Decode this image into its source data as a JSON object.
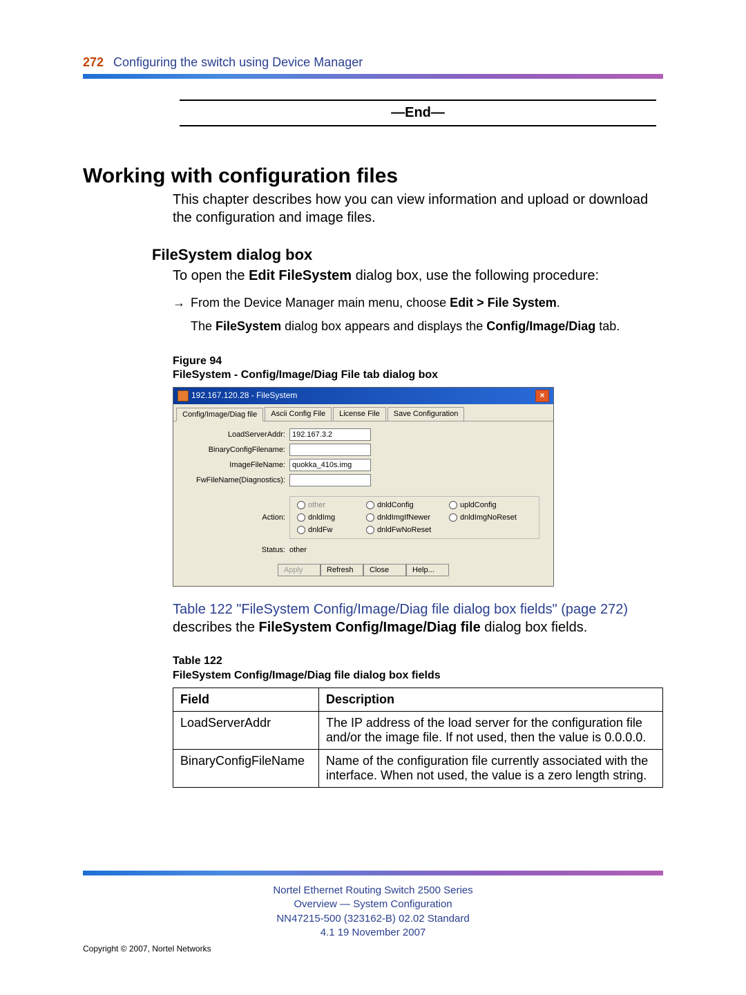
{
  "header": {
    "page_number": "272",
    "chapter": "Configuring the switch using Device Manager"
  },
  "end_marker": "—End—",
  "h1": "Working with configuration files",
  "intro": "This chapter describes how you can view information and upload or download the configuration and image files.",
  "h2": "FileSystem dialog box",
  "open_line_pre": "To open the ",
  "open_line_bold": "Edit FileSystem",
  "open_line_post": " dialog box, use the following procedure:",
  "step_arrow": "→",
  "step1_pre": "From the Device Manager main menu, choose ",
  "step1_bold": "Edit > File System",
  "step1_post": ".",
  "step2a": "The ",
  "step2b": "FileSystem",
  "step2c": " dialog box appears and displays the ",
  "step2d": "Config/Image/Diag",
  "step2e": " tab.",
  "figure_label": "Figure 94",
  "figure_title": "FileSystem - Config/Image/Diag File tab dialog box",
  "dialog": {
    "title": "192.167.120.28 - FileSystem",
    "close": "×",
    "tabs": [
      "Config/Image/Diag file",
      "Ascii Config File",
      "License File",
      "Save Configuration"
    ],
    "labels": {
      "load": "LoadServerAddr:",
      "binary": "BinaryConfigFilename:",
      "image": "ImageFileName:",
      "fw": "FwFileName(Diagnostics):",
      "action": "Action:",
      "status_label": "Status:",
      "status_value": "other"
    },
    "values": {
      "load": "192.167.3.2",
      "binary": "",
      "image": "quokka_410s.img",
      "fw": ""
    },
    "radios": [
      "other",
      "dnldConfig",
      "upldConfig",
      "dnldImg",
      "dnldImgIfNewer",
      "dnldImgNoReset",
      "dnldFw",
      "dnldFwNoReset"
    ],
    "buttons": [
      "Apply",
      "Refresh",
      "Close",
      "Help..."
    ]
  },
  "table_ref_link": "Table 122 \"FileSystem Config/Image/Diag file dialog box fields\" (page 272)",
  "table_ref_plain_a": " describes the ",
  "table_ref_bold": "FileSystem Config/Image/Diag file",
  "table_ref_plain_b": " dialog box fields.",
  "table_label": "Table 122",
  "table_title": "FileSystem Config/Image/Diag file dialog box fields",
  "table_headers": [
    "Field",
    "Description"
  ],
  "table_rows": [
    {
      "field": "LoadServerAddr",
      "desc": "The IP address of the load server for the configuration file and/or the image file. If not used, then the value is 0.0.0.0."
    },
    {
      "field": "BinaryConfigFileName",
      "desc": "Name of the configuration file currently associated with the interface. When not used, the value is a zero length string."
    }
  ],
  "footer": {
    "l1": "Nortel Ethernet Routing Switch 2500 Series",
    "l2": "Overview — System Configuration",
    "l3": "NN47215-500 (323162-B)   02.02   Standard",
    "l4": "4.1   19 November 2007",
    "copyright": "Copyright © 2007, Nortel Networks"
  }
}
